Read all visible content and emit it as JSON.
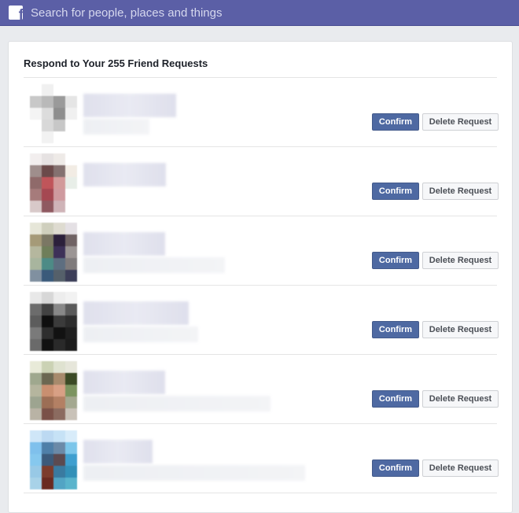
{
  "header": {
    "logo_icon": "facebook-f-icon",
    "logo_glyph": "f",
    "search_placeholder": "Search for people, places and things",
    "bar_color": "#5b5fa6"
  },
  "requests_panel": {
    "title": "Respond to Your 255 Friend Requests",
    "confirm_label": "Confirm",
    "delete_label": "Delete Request",
    "accent_color": "#4e69a2",
    "rows": [
      {
        "avatar": [
          "#ffffff",
          "#f0f0f0",
          "#ffffff",
          "#ffffff",
          "#c8c8c8",
          "#b9b9b9",
          "#9a9a9a",
          "#e5e5e5",
          "#f4f4f4",
          "#dcdcdc",
          "#8e8e8e",
          "#f0f0f0",
          "#ffffff",
          "#d8d8d8",
          "#c7c7c7",
          "#ffffff",
          "#ffffff",
          "#f2f2f2",
          "#ffffff",
          "#ffffff"
        ]
      },
      {
        "avatar": [
          "#f2eeee",
          "#e6e2e2",
          "#eeeae7",
          "#ffffff",
          "#9f8e8c",
          "#6b4a4a",
          "#847170",
          "#f2ece4",
          "#8f6a6a",
          "#c0555a",
          "#d29a9a",
          "#e8eee8",
          "#a67b7b",
          "#a54852",
          "#cf9a9f",
          "#ffffff",
          "#d8c9c9",
          "#8f5960",
          "#cfb4b8",
          "#ffffff"
        ]
      },
      {
        "avatar": [
          "#e6e6d8",
          "#cfcfbd",
          "#dedbd0",
          "#e4e0e4",
          "#a59a78",
          "#7b7764",
          "#2c203b",
          "#706364",
          "#b5b79e",
          "#6f7e5a",
          "#3d3158",
          "#9b9594",
          "#a8b59e",
          "#4d8b86",
          "#5d6e80",
          "#7f7b7c",
          "#8090a0",
          "#3a5a7a",
          "#55606a",
          "#3c3e58"
        ]
      },
      {
        "avatar": [
          "#e8e8e8",
          "#d7d7d7",
          "#ededed",
          "#f2f2f2",
          "#6c6c6c",
          "#424242",
          "#888888",
          "#5a5a5a",
          "#5c5c5c",
          "#0f0f0f",
          "#3b3b3b",
          "#2d2d2d",
          "#7a7a7a",
          "#2e2e2e",
          "#121212",
          "#1f1f1f",
          "#6a6a6a",
          "#111111",
          "#2a2a2a",
          "#1c1c1c"
        ]
      },
      {
        "avatar": [
          "#e8ead8",
          "#cbd2b4",
          "#dfe2d0",
          "#e6e6da",
          "#9fa88e",
          "#6b6751",
          "#a78a6c",
          "#3b4a25",
          "#b5b59e",
          "#c98f70",
          "#d8a085",
          "#7c9460",
          "#9da490",
          "#9c6e55",
          "#b38064",
          "#a4a890",
          "#b9b3a5",
          "#7a5148",
          "#8b6b60",
          "#c9c2b8"
        ]
      },
      {
        "avatar": [
          "#cfe6f8",
          "#bcd9f2",
          "#c6e2f6",
          "#d8ecfa",
          "#7fc0ec",
          "#4f7fa8",
          "#6b8aa8",
          "#7cc6ea",
          "#86c8ee",
          "#3c5a7a",
          "#5c4a50",
          "#3f9fcf",
          "#98c9e6",
          "#7c3c2c",
          "#3a7aa0",
          "#3390b8",
          "#a8d2e8",
          "#6a2a20",
          "#52a4c4",
          "#5ab4cc"
        ]
      }
    ]
  }
}
